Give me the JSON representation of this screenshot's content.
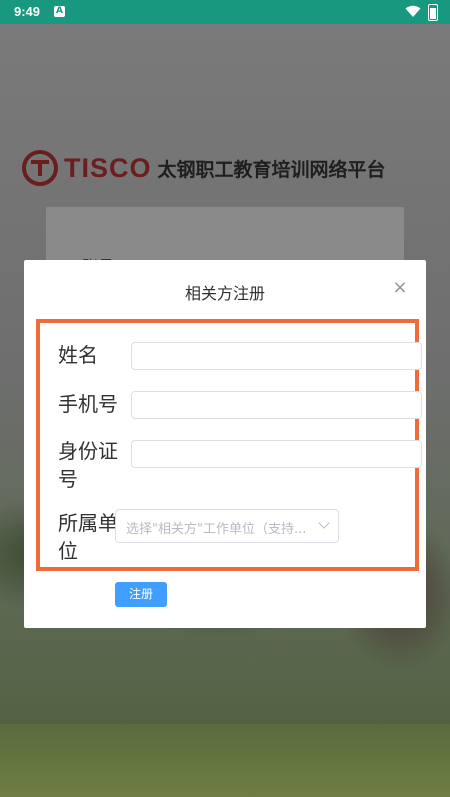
{
  "status_bar": {
    "time": "9:49",
    "notification_icon": "a-icon",
    "wifi_icon": "wifi-icon",
    "battery_icon": "battery-icon"
  },
  "background": {
    "brand": "TISCO",
    "platform_title": "太钢职工教育培训网络平台",
    "account_label": "账号"
  },
  "dialog": {
    "title": "相关方注册",
    "close_label": "×",
    "fields": [
      {
        "label": "姓名",
        "value": ""
      },
      {
        "label": "手机号",
        "value": ""
      },
      {
        "label": "身份证号",
        "value": ""
      }
    ],
    "unit": {
      "label": "所属单位",
      "placeholder": "选择\"相关方\"工作单位（支持..."
    },
    "submit_label": "注册"
  },
  "colors": {
    "status_bar": "#18997f",
    "highlight_border": "#ef6b3a",
    "primary_button": "#409eff",
    "brand": "#6a1e1e"
  }
}
